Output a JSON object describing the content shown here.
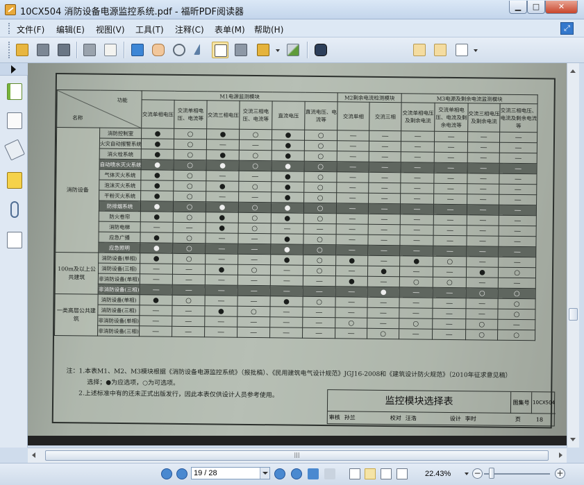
{
  "window": {
    "title": "10CX504 消防设备电源监控系统.pdf - 福昕PDF阅读器",
    "minimize": "▁",
    "maximize": "□",
    "close": "✕"
  },
  "menu": [
    "文件(F)",
    "编辑(E)",
    "视图(V)",
    "工具(T)",
    "注释(C)",
    "表单(M)",
    "帮助(H)"
  ],
  "toolbar": {
    "search_value": ""
  },
  "document": {
    "table": {
      "corner_top": "功能",
      "corner_bottom": "名称",
      "groups": [
        "M1电源监测模块",
        "M2剩余电流检测模块",
        "M3电源及剩余电流监测模块"
      ],
      "columns": [
        "交流单相电压",
        "交流单相电压、电流等",
        "交流三相电压",
        "交流三相电压、电流等",
        "直流电压",
        "直流电压、电流等",
        "交流单相",
        "交流三相",
        "交流单相电压及剩余电流",
        "交流单相电压、电流及剩余电流等",
        "交流三相电压及剩余电流",
        "交流三相电压、电流及剩余电流等"
      ],
      "row_groups": [
        "消防设备",
        "100m及以上公共建筑",
        "一类高层公共建筑"
      ],
      "rows": [
        {
          "name": "消防控制室",
          "cells": [
            "●",
            "○",
            "●",
            "○",
            "●",
            "○",
            "—",
            "—",
            "—",
            "—",
            "—",
            "—"
          ]
        },
        {
          "name": "火灾自动报警系统",
          "cells": [
            "●",
            "○",
            "—",
            "—",
            "●",
            "○",
            "—",
            "—",
            "—",
            "—",
            "—",
            "—"
          ]
        },
        {
          "name": "消火栓系统",
          "cells": [
            "●",
            "○",
            "●",
            "○",
            "●",
            "○",
            "—",
            "—",
            "—",
            "—",
            "—",
            "—"
          ]
        },
        {
          "name": "自动喷水灭火系统",
          "cells": [
            "●",
            "○",
            "●",
            "○",
            "●",
            "○",
            "—",
            "—",
            "—",
            "—",
            "—",
            "—"
          ]
        },
        {
          "name": "气体灭火系统",
          "cells": [
            "●",
            "○",
            "—",
            "—",
            "●",
            "○",
            "—",
            "—",
            "—",
            "—",
            "—",
            "—"
          ]
        },
        {
          "name": "泡沫灭火系统",
          "cells": [
            "●",
            "○",
            "●",
            "○",
            "●",
            "○",
            "—",
            "—",
            "—",
            "—",
            "—",
            "—"
          ]
        },
        {
          "name": "干粉灭火系统",
          "cells": [
            "●",
            "○",
            "—",
            "—",
            "●",
            "○",
            "—",
            "—",
            "—",
            "—",
            "—",
            "—"
          ]
        },
        {
          "name": "防排烟系统",
          "cells": [
            "●",
            "○",
            "●",
            "○",
            "●",
            "○",
            "—",
            "—",
            "—",
            "—",
            "—",
            "—"
          ]
        },
        {
          "name": "防火卷帘",
          "cells": [
            "●",
            "○",
            "●",
            "○",
            "●",
            "○",
            "—",
            "—",
            "—",
            "—",
            "—",
            "—"
          ]
        },
        {
          "name": "消防电梯",
          "cells": [
            "—",
            "—",
            "●",
            "○",
            "—",
            "—",
            "—",
            "—",
            "—",
            "—",
            "—",
            "—"
          ]
        },
        {
          "name": "应急广播",
          "cells": [
            "●",
            "○",
            "—",
            "—",
            "●",
            "○",
            "—",
            "—",
            "—",
            "—",
            "—",
            "—"
          ]
        },
        {
          "name": "应急照明",
          "cells": [
            "●",
            "○",
            "—",
            "—",
            "●",
            "○",
            "—",
            "—",
            "—",
            "—",
            "—",
            "—"
          ]
        },
        {
          "name": "消防设备(单相)",
          "cells": [
            "●",
            "○",
            "—",
            "—",
            "●",
            "○",
            "●",
            "—",
            "●",
            "○",
            "—",
            "—"
          ]
        },
        {
          "name": "消防设备(三相)",
          "cells": [
            "—",
            "—",
            "●",
            "○",
            "—",
            "○",
            "—",
            "●",
            "—",
            "—",
            "●",
            "○"
          ]
        },
        {
          "name": "非消防设备(单相)",
          "cells": [
            "—",
            "—",
            "—",
            "—",
            "—",
            "—",
            "●",
            "—",
            "○",
            "○",
            "—",
            "—"
          ]
        },
        {
          "name": "非消防设备(三相)",
          "cells": [
            "—",
            "—",
            "—",
            "—",
            "—",
            "—",
            "—",
            "●",
            "—",
            "—",
            "○",
            "○"
          ]
        },
        {
          "name": "消防设备(单相)",
          "cells": [
            "●",
            "○",
            "—",
            "—",
            "●",
            "○",
            "—",
            "—",
            "—",
            "—",
            "—",
            "○"
          ]
        },
        {
          "name": "消防设备(三相)",
          "cells": [
            "—",
            "—",
            "●",
            "○",
            "—",
            "—",
            "—",
            "—",
            "—",
            "—",
            "—",
            "○"
          ]
        },
        {
          "name": "非消防设备(单相)",
          "cells": [
            "—",
            "—",
            "—",
            "—",
            "—",
            "—",
            "○",
            "—",
            "○",
            "—",
            "○",
            "—"
          ]
        },
        {
          "name": "非消防设备(三相)",
          "cells": [
            "—",
            "—",
            "—",
            "—",
            "—",
            "—",
            "—",
            "○",
            "—",
            "—",
            "○",
            "○"
          ]
        }
      ]
    },
    "notes": [
      "注：1.本表M1、M2、M3模块根据《消防设备电源监控系统》（报批稿）、《民用建筑电气设计规范》JGJ16-2008和《建筑设计防火规范》（2010年征求意见稿）",
      "选择；●为应选项，○为可选项。",
      "2.上述标准中有的还未正式出版发行，因此本表仅供设计人员参考使用。"
    ],
    "title_block": {
      "title": "监控模块选择表",
      "atlas_label": "图集号",
      "atlas_number": "10CX504",
      "review_label": "审核",
      "reviewer": "孙兰",
      "check_label": "校对",
      "checker": "汪浩",
      "design_label": "设计",
      "designer": "李时",
      "page_label": "页",
      "page_number": "18"
    }
  },
  "statusbar": {
    "page": "19 / 28",
    "zoom": "22.43%"
  },
  "colors": {
    "titlebar": "#c3d5eb",
    "menubar": "#dde8f4",
    "doc_paper": "#a8b0a6",
    "band_row": "#5f665f"
  }
}
